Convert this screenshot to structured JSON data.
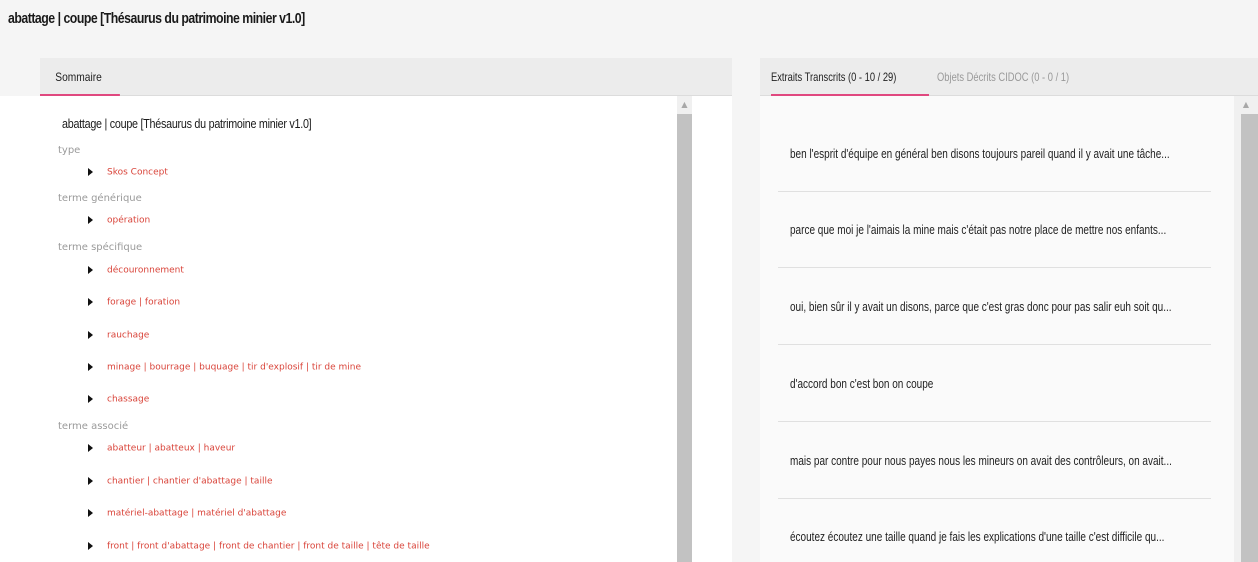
{
  "page": {
    "title": "abattage | coupe [Thésaurus du patrimoine minier v1.0]"
  },
  "left": {
    "tab_label": "Sommaire",
    "concept_title": "abattage | coupe [Thésaurus du patrimoine minier v1.0]",
    "sections": [
      {
        "label": "type",
        "items": [
          "Skos Concept"
        ]
      },
      {
        "label": "terme générique",
        "items": [
          "opération"
        ]
      },
      {
        "label": "terme spécifique",
        "items": [
          "découronnement",
          "forage | foration",
          "rauchage",
          "minage | bourrage | buquage | tir d'explosif | tir de mine",
          "chassage"
        ]
      },
      {
        "label": "terme associé",
        "items": [
          "abatteur | abatteux | haveur",
          "chantier | chantier d'abattage | taille",
          "matériel-abattage | matériel d'abattage",
          "front | front d'abattage | front de chantier | front de taille | tête de taille"
        ]
      }
    ]
  },
  "right": {
    "tabs": [
      {
        "label": "Extraits Transcrits (0 - 10 / 29)",
        "active": true
      },
      {
        "label": "Objets Décrits CIDOC (0 - 0 / 1)",
        "active": false
      }
    ],
    "extracts": [
      "ben l'esprit d'équipe en général ben disons toujours pareil quand il y avait une tâche...",
      "parce que moi je l'aimais la mine mais c'était pas notre place de mettre nos enfants...",
      "oui, bien sûr il y avait un disons, parce que c'est gras donc pour pas salir euh soit qu...",
      "d'accord bon c'est bon on coupe",
      "mais par contre pour nous payes nous les mineurs on avait des contrôleurs, on avait...",
      "écoutez écoutez une taille quand je fais les explications d'une taille c'est difficile qu..."
    ]
  },
  "colors": {
    "accent": "#e0487f",
    "link": "#d9443a",
    "muted": "#9a9a9a"
  },
  "icons": {
    "bullet": "caret-right-icon",
    "scroll_up": "arrow-up-icon"
  }
}
